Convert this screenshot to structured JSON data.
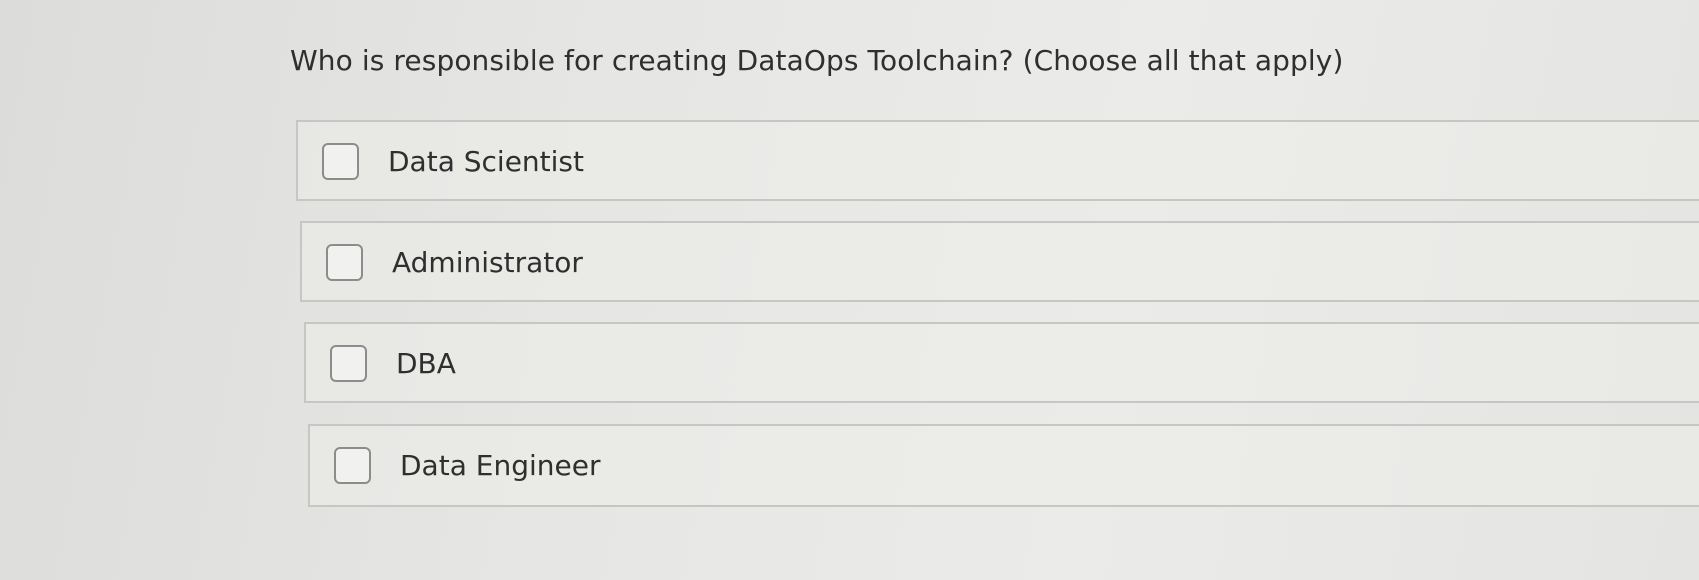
{
  "question": {
    "text": "Who is responsible for creating DataOps Toolchain? (Choose all that apply)"
  },
  "options": [
    {
      "label": "Data Scientist",
      "checked": false
    },
    {
      "label": "Administrator",
      "checked": false
    },
    {
      "label": "DBA",
      "checked": false
    },
    {
      "label": "Data Engineer",
      "checked": false
    }
  ]
}
